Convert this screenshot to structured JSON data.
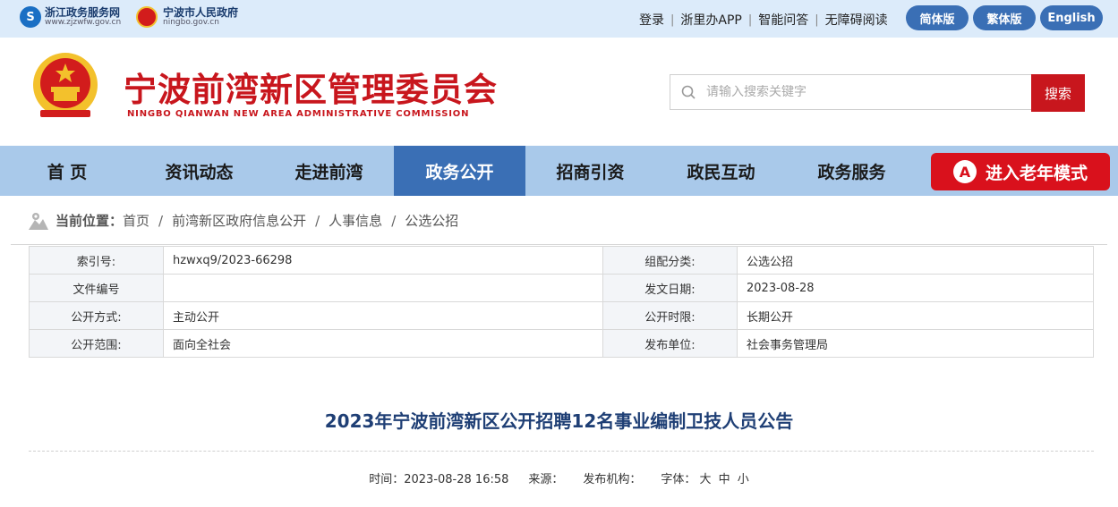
{
  "topbar": {
    "logo1_cn": "浙江政务服务网",
    "logo1_en": "www.zjzwfw.gov.cn",
    "logo2_cn": "宁波市人民政府",
    "logo2_en": "ningbo.gov.cn",
    "links": [
      "登录",
      "浙里办APP",
      "智能问答",
      "无障碍阅读"
    ],
    "pill_simplified": "简体版",
    "pill_traditional": "繁体版",
    "pill_english": "English"
  },
  "header": {
    "title": "宁波前湾新区管理委员会",
    "subtitle": "NINGBO QIANWAN NEW AREA ADMINISTRATIVE COMMISSION",
    "search_placeholder": "请输入搜索关键字",
    "search_button": "搜索"
  },
  "nav": {
    "items": [
      "首 页",
      "资讯动态",
      "走进前湾",
      "政务公开",
      "招商引资",
      "政民互动",
      "政务服务"
    ],
    "active": "政务公开",
    "elder_mode": "进入老年模式"
  },
  "breadcrumb": {
    "label": "当前位置：",
    "items": [
      "首页",
      "前湾新区政府信息公开",
      "人事信息",
      "公选公招"
    ]
  },
  "info": {
    "rows": [
      {
        "k1": "索引号:",
        "v1": "hzwxq9/2023-66298",
        "k2": "组配分类:",
        "v2": "公选公招"
      },
      {
        "k1": "文件编号",
        "v1": "",
        "k2": "发文日期:",
        "v2": "2023-08-28"
      },
      {
        "k1": "公开方式:",
        "v1": "主动公开",
        "k2": "公开时限:",
        "v2": "长期公开"
      },
      {
        "k1": "公开范围:",
        "v1": "面向全社会",
        "k2": "发布单位:",
        "v2": "社会事务管理局"
      }
    ]
  },
  "article": {
    "title": "2023年宁波前湾新区公开招聘12名事业编制卫技人员公告",
    "time_label": "时间：",
    "time_value": "2023-08-28 16:58",
    "source_label": "来源：",
    "publisher_label": "发布机构：",
    "font_label": "字体：",
    "font_large": "大",
    "font_medium": "中",
    "font_small": "小"
  },
  "colors": {
    "brand_red": "#c8161d",
    "nav_bg": "#a9c9ea",
    "nav_active": "#3a6fb5",
    "topbar_bg": "#dcebfa"
  }
}
